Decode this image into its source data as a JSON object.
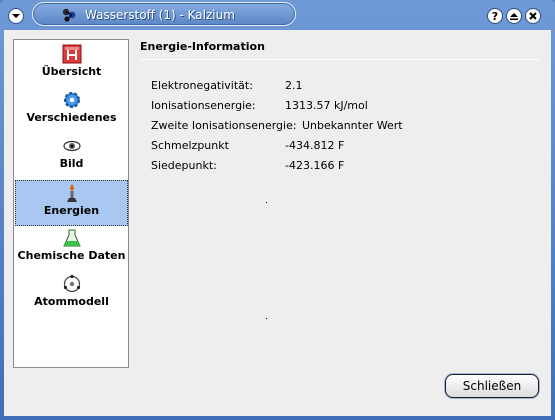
{
  "window": {
    "title": "Wasserstoff (1) - Kalzium",
    "buttons": {
      "help": "?"
    }
  },
  "sidebar": {
    "items": [
      {
        "label": "Übersicht",
        "icon": "element-h-icon"
      },
      {
        "label": "Verschiedenes",
        "icon": "gear-icon"
      },
      {
        "label": "Bild",
        "icon": "eye-icon"
      },
      {
        "label": "Energien",
        "icon": "bunsen-burner-icon",
        "active": true
      },
      {
        "label": "Chemische Daten",
        "icon": "flask-icon"
      },
      {
        "label": "Atommodell",
        "icon": "atom-icon"
      }
    ]
  },
  "main": {
    "section_title": "Energie-Information",
    "rows": [
      {
        "key": "Elektronegativität:",
        "value": "2.1"
      },
      {
        "key": "Ionisationsenergie:",
        "value": "1313.57 kJ/mol"
      },
      {
        "key": "Zweite Ionisationsenergie:",
        "value": "Unbekannter Wert"
      },
      {
        "key": "Schmelzpunkt",
        "value": "-434.812 F"
      },
      {
        "key": "Siedepunkt:",
        "value": "-423.166 F"
      }
    ]
  },
  "footer": {
    "close_label": "Schließen"
  },
  "colors": {
    "title_bar": "#5c86c6",
    "sidebar_active": "#a8c8f2",
    "client_bg": "#eeeeee"
  }
}
